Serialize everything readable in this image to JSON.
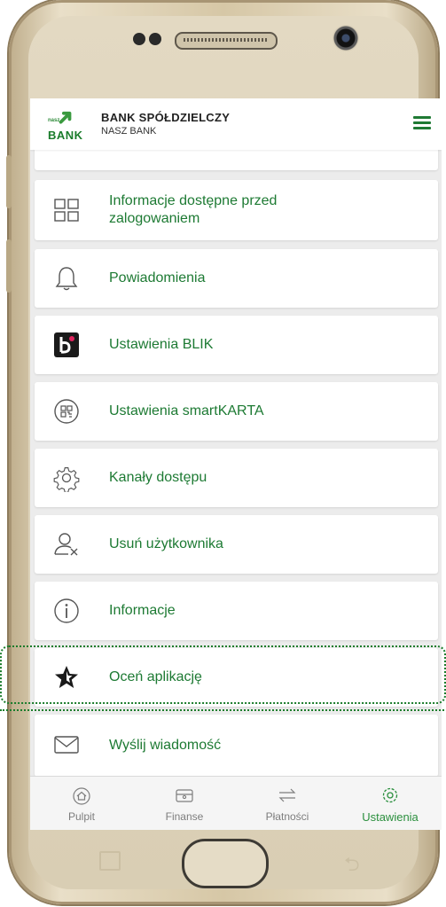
{
  "header": {
    "logo_small": "nasz",
    "logo_word": "BANK",
    "bank_name": "BANK SPÓŁDZIELCZY",
    "bank_subtitle": "NASZ BANK"
  },
  "settings_items": [
    {
      "label": "Informacje dostępne przed zalogowaniem",
      "icon": "grid-icon"
    },
    {
      "label": "Powiadomienia",
      "icon": "bell-icon"
    },
    {
      "label": "Ustawienia BLIK",
      "icon": "blik-icon"
    },
    {
      "label": "Ustawienia smartKARTA",
      "icon": "smartkarta-icon"
    },
    {
      "label": "Kanały dostępu",
      "icon": "gear-icon"
    },
    {
      "label": "Usuń użytkownika",
      "icon": "remove-user-icon"
    },
    {
      "label": "Informacje",
      "icon": "info-icon"
    },
    {
      "label": "Oceń aplikację",
      "icon": "star-icon"
    },
    {
      "label": "Wyślij wiadomość",
      "icon": "envelope-icon"
    }
  ],
  "bottom_nav": {
    "items": [
      {
        "label": "Pulpit",
        "icon": "home-icon"
      },
      {
        "label": "Finanse",
        "icon": "wallet-icon"
      },
      {
        "label": "Płatności",
        "icon": "transfer-arrows-icon"
      },
      {
        "label": "Ustawienia",
        "icon": "gear-icon"
      }
    ],
    "active": "Ustawienia"
  },
  "colors": {
    "accent_green": "#1d7a33",
    "active_nav": "#2a8f3d",
    "inactive_nav": "#7d7d7d",
    "screen_bg": "#ececec"
  }
}
